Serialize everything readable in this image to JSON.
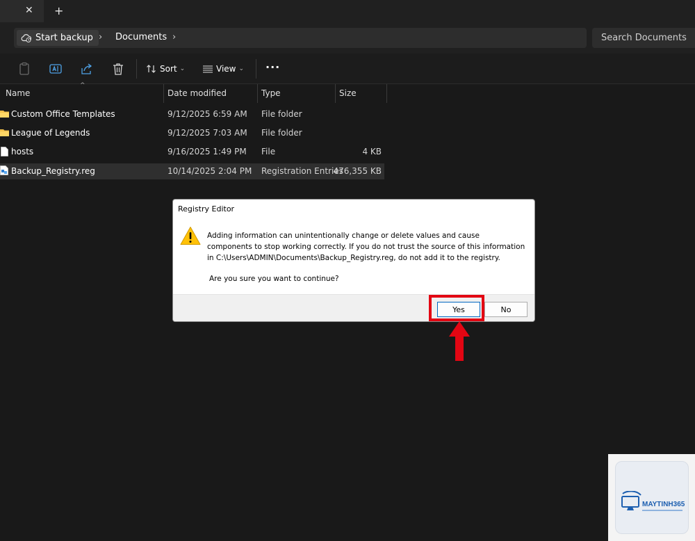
{
  "tabbar": {
    "close_glyph": "✕",
    "new_glyph": "+"
  },
  "address": {
    "crumbs": [
      "Start backup",
      "Documents"
    ],
    "search_placeholder": "Search Documents"
  },
  "toolbar": {
    "sort_label": "Sort",
    "view_label": "View",
    "more_glyph": "···"
  },
  "columns": [
    "Name",
    "Date modified",
    "Type",
    "Size"
  ],
  "files": [
    {
      "name": "Custom Office Templates",
      "date": "9/12/2025 6:59 AM",
      "type": "File folder",
      "size": "",
      "icon": "folder-icon"
    },
    {
      "name": "League of Legends",
      "date": "9/12/2025 7:03 AM",
      "type": "File folder",
      "size": "",
      "icon": "folder-icon"
    },
    {
      "name": "hosts",
      "date": "9/16/2025 1:49 PM",
      "type": "File",
      "size": "4 KB",
      "icon": "file-icon"
    },
    {
      "name": "Backup_Registry.reg",
      "date": "10/14/2025 2:04 PM",
      "type": "Registration Entries",
      "size": "476,355 KB",
      "icon": "registry-file-icon"
    }
  ],
  "dialog": {
    "title": "Registry Editor",
    "message": "Adding information can unintentionally change or delete values and cause components to stop working correctly. If you do not trust the source of this information in C:\\Users\\ADMIN\\Documents\\Backup_Registry.reg, do not add it to the registry.",
    "question": "Are you sure you want to continue?",
    "yes_label": "Yes",
    "no_label": "No"
  },
  "watermark": {
    "brand": "MAYTINH365"
  },
  "colors": {
    "highlight": "#e30613",
    "background": "#191919",
    "accent": "#0067c0"
  }
}
